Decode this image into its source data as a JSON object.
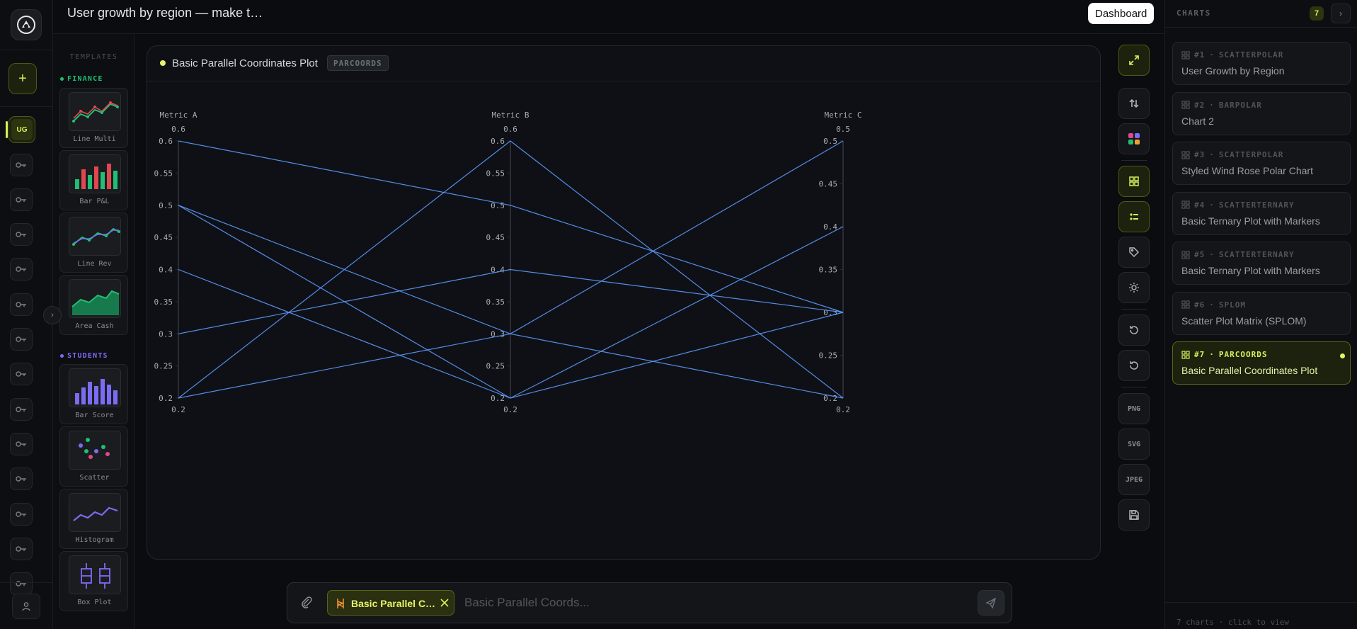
{
  "app": {
    "title": "User growth by region — make t…",
    "dashboard_label": "Dashboard",
    "active_project_initials": "UG"
  },
  "templates": {
    "heading": "TEMPLATES",
    "groups": [
      {
        "name": "FINANCE",
        "color": "#1fbf74"
      },
      {
        "name": "STUDENTS",
        "color": "#7b6cf6"
      }
    ],
    "items": [
      {
        "label": "Line Multi",
        "icon": "line-multi-thumb"
      },
      {
        "label": "Bar P&L",
        "icon": "bar-pl-thumb"
      },
      {
        "label": "Line Rev",
        "icon": "line-rev-thumb"
      },
      {
        "label": "Area Cash",
        "icon": "area-cash-thumb"
      },
      {
        "label": "Bar Score",
        "icon": "bar-score-thumb"
      },
      {
        "label": "Scatter",
        "icon": "scatter-thumb"
      },
      {
        "label": "Histogram",
        "icon": "histogram-thumb"
      },
      {
        "label": "Box Plot",
        "icon": "box-plot-thumb"
      }
    ]
  },
  "card": {
    "title": "Basic Parallel Coordinates Plot",
    "type_badge": "PARCOORDS"
  },
  "chart_data": {
    "type": "parallel-coordinates",
    "dimensions": [
      {
        "label": "Metric A",
        "range": [
          0.2,
          0.6
        ],
        "ticks": [
          "0.2",
          "0.25",
          "0.3",
          "0.35",
          "0.4",
          "0.45",
          "0.5",
          "0.55",
          "0.6"
        ],
        "tick_values": [
          0.2,
          0.25,
          0.3,
          0.35,
          0.4,
          0.45,
          0.5,
          0.55,
          0.6
        ],
        "max_label": "0.6",
        "min_label": "0.2"
      },
      {
        "label": "Metric B",
        "range": [
          0.2,
          0.6
        ],
        "ticks": [
          "0.2",
          "0.25",
          "0.3",
          "0.35",
          "0.4",
          "0.45",
          "0.5",
          "0.55",
          "0.6"
        ],
        "tick_values": [
          0.2,
          0.25,
          0.3,
          0.35,
          0.4,
          0.45,
          0.5,
          0.55,
          0.6
        ],
        "max_label": "0.6",
        "min_label": "0.2"
      },
      {
        "label": "Metric C",
        "range": [
          0.2,
          0.5
        ],
        "ticks": [
          "0.2",
          "0.25",
          "0.3",
          "0.35",
          "0.4",
          "0.45",
          "0.5"
        ],
        "tick_values": [
          0.2,
          0.25,
          0.3,
          0.35,
          0.4,
          0.45,
          0.5
        ],
        "max_label": "0.5",
        "min_label": "0.2"
      }
    ],
    "lines": [
      [
        0.6,
        0.5,
        0.3
      ],
      [
        0.5,
        0.3,
        0.2
      ],
      [
        0.5,
        0.2,
        0.4
      ],
      [
        0.4,
        0.2,
        0.3
      ],
      [
        0.3,
        0.4,
        0.3
      ],
      [
        0.2,
        0.6,
        0.2
      ],
      [
        0.2,
        0.3,
        0.5
      ]
    ],
    "line_color": "#5b9bff",
    "axis_color": "#2a2d33",
    "label_color": "#a7abb2"
  },
  "toolbar": {
    "export_png": "PNG",
    "export_svg": "SVG",
    "export_jpeg": "JPEG"
  },
  "composer": {
    "chip_label": "Basic Parallel C…",
    "placeholder": "Basic Parallel Coords..."
  },
  "charts_panel": {
    "heading": "CHARTS",
    "count": "7",
    "footer": "7 charts · click to view",
    "items": [
      {
        "num": "#1",
        "type": "SCATTERPOLAR",
        "name": "User Growth by Region"
      },
      {
        "num": "#2",
        "type": "BARPOLAR",
        "name": "Chart 2"
      },
      {
        "num": "#3",
        "type": "SCATTERPOLAR",
        "name": "Styled Wind Rose Polar Chart"
      },
      {
        "num": "#4",
        "type": "SCATTERTERNARY",
        "name": "Basic Ternary Plot with Markers"
      },
      {
        "num": "#5",
        "type": "SCATTERTERNARY",
        "name": "Basic Ternary Plot with Markers"
      },
      {
        "num": "#6",
        "type": "SPLOM",
        "name": "Scatter Plot Matrix (SPLOM)"
      },
      {
        "num": "#7",
        "type": "PARCOORDS",
        "name": "Basic Parallel Coordinates Plot"
      }
    ]
  },
  "colors": {
    "accent": "#d9f05a",
    "accent_bg": "#1d220e"
  }
}
